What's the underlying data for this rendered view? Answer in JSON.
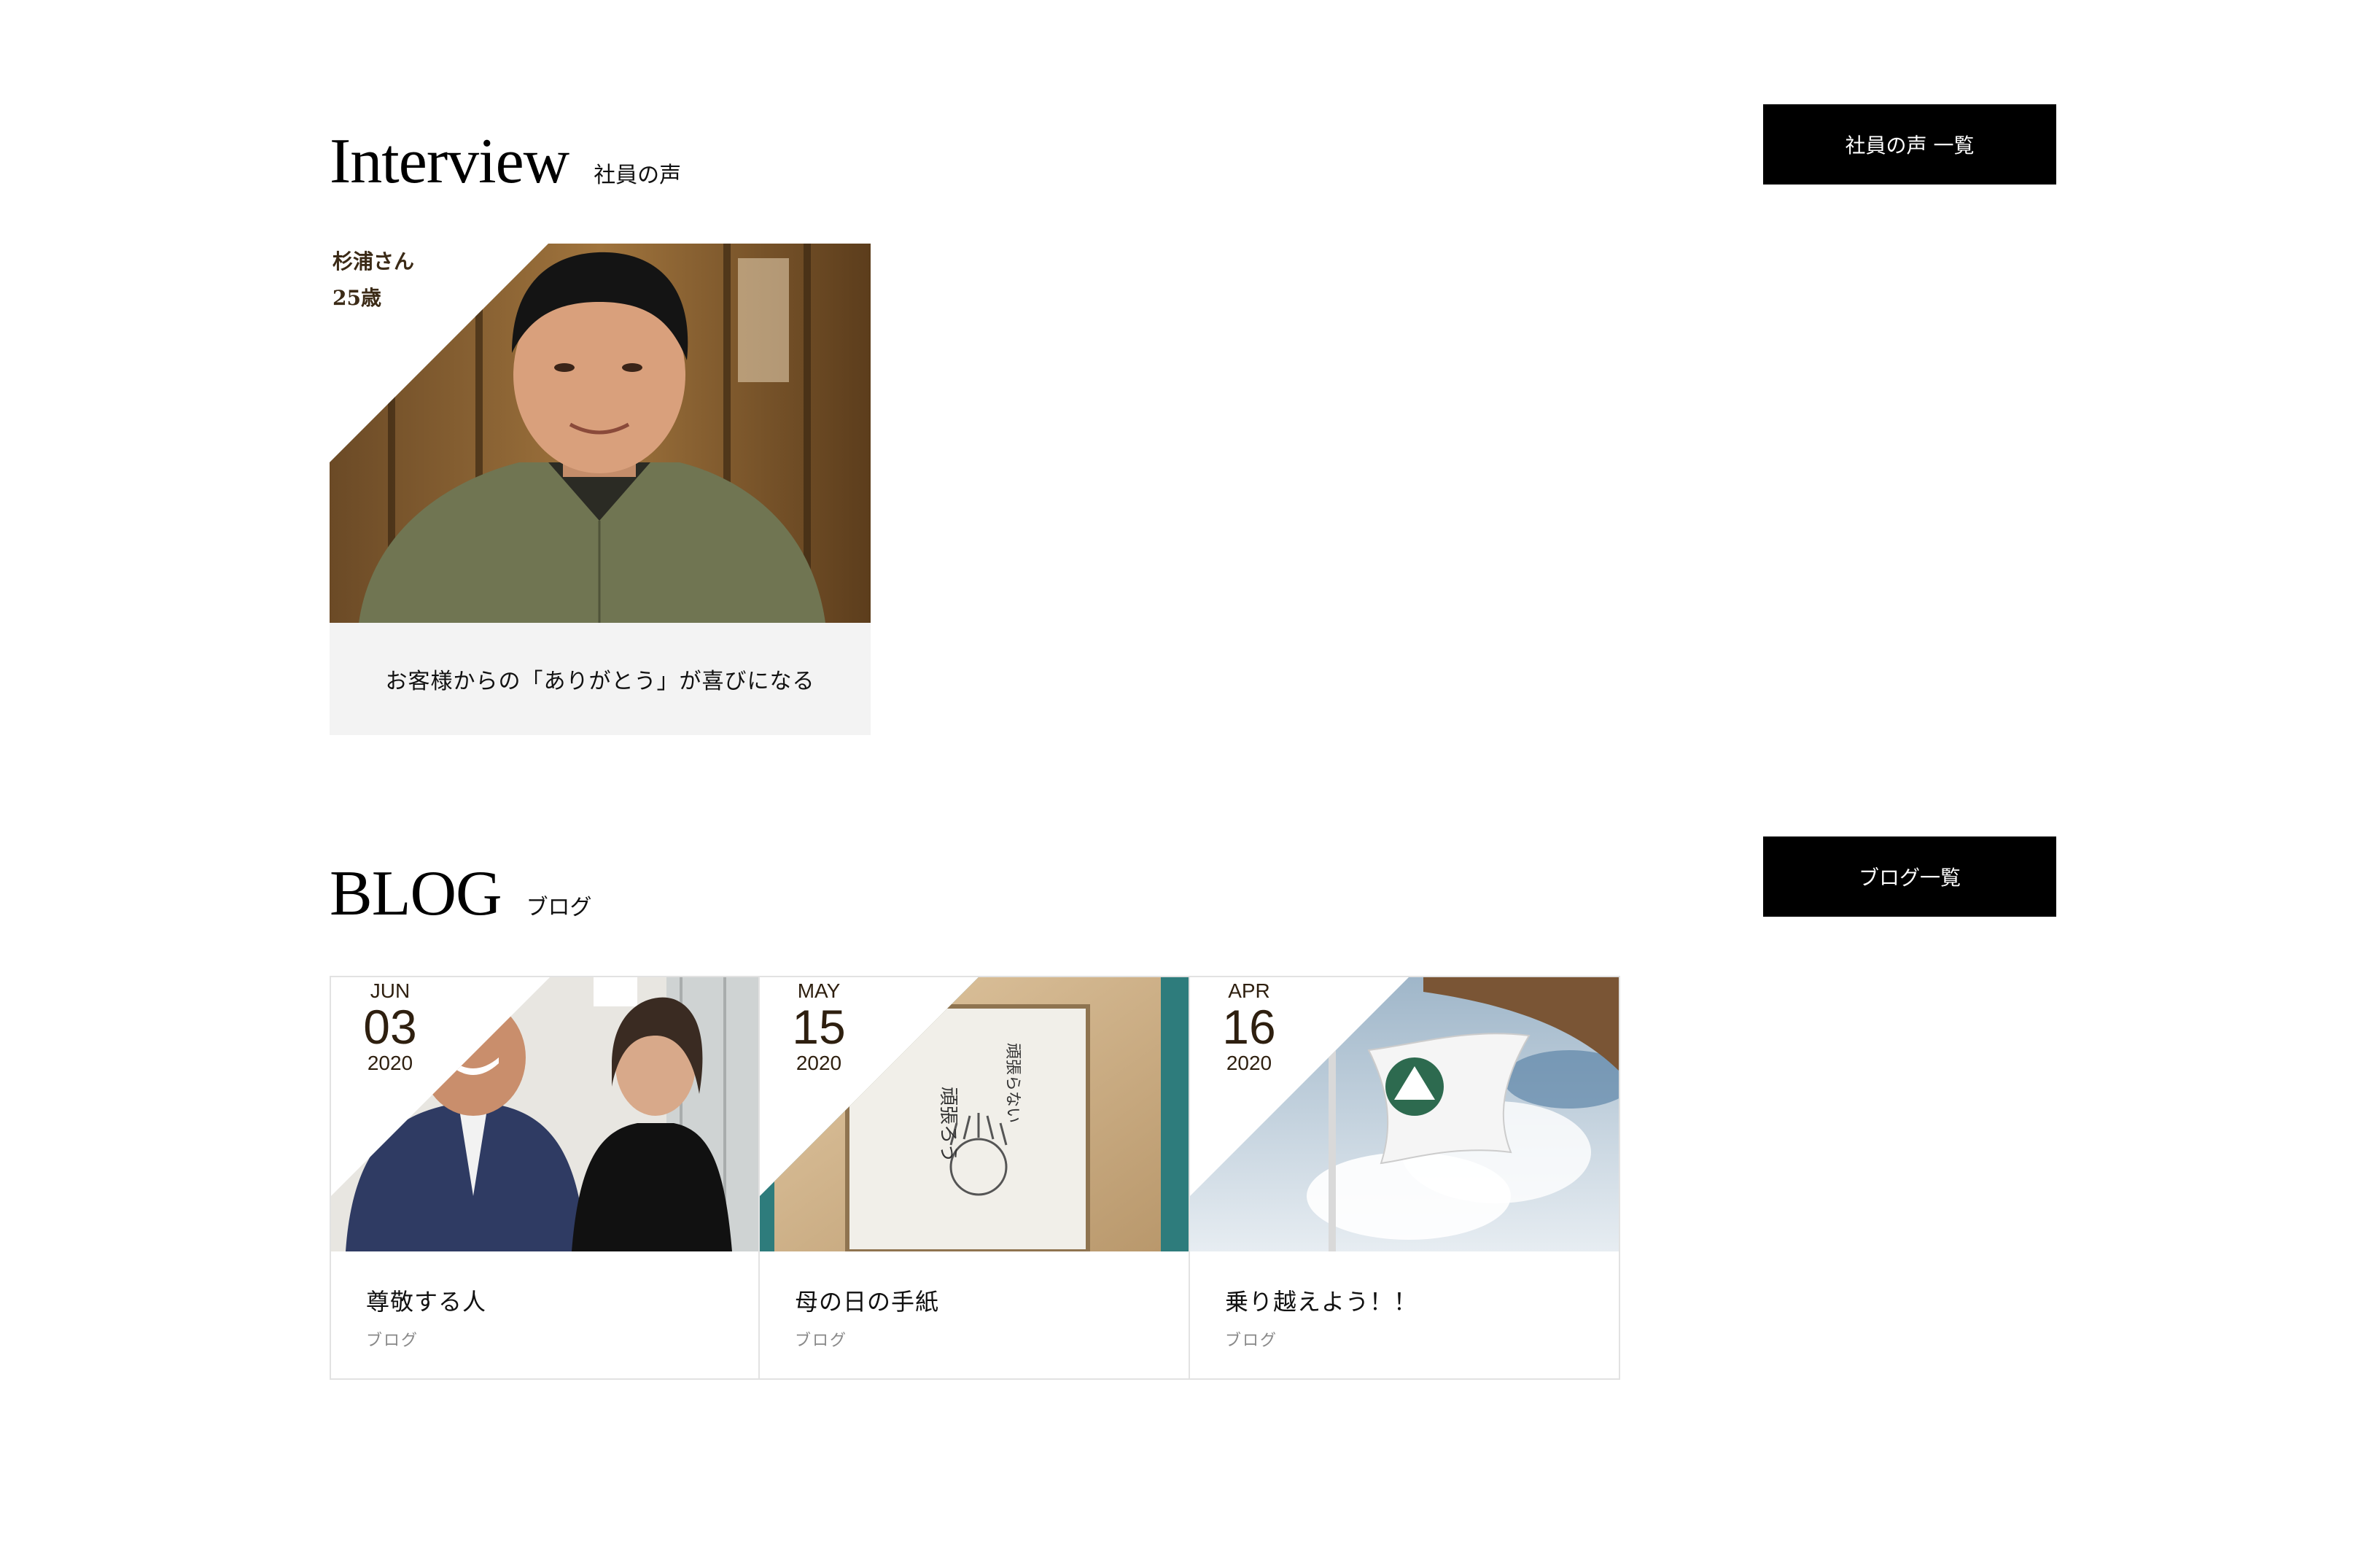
{
  "interview": {
    "title": "Interview",
    "subtitle": "社員の声",
    "list_button": "社員の声 一覧",
    "card": {
      "name": "杉浦さん",
      "age": "25歳",
      "caption": "お客様からの「ありがとう」が喜びになる"
    }
  },
  "blog": {
    "title": "BLOG",
    "subtitle": "ブログ",
    "list_button": "ブログ一覧",
    "posts": [
      {
        "month": "JUN",
        "day": "03",
        "year": "2020",
        "title": "尊敬する人",
        "category": "ブログ"
      },
      {
        "month": "MAY",
        "day": "15",
        "year": "2020",
        "title": "母の日の手紙",
        "category": "ブログ"
      },
      {
        "month": "APR",
        "day": "16",
        "year": "2020",
        "title": "乗り越えよう！！",
        "category": "ブログ"
      }
    ]
  },
  "images": {
    "interview_photo": "portrait-photo",
    "blog_photo_1": "two-people-photo",
    "blog_photo_2": "framed-letter-photo",
    "blog_photo_3": "company-flag-photo"
  },
  "colors": {
    "button_bg": "#000000",
    "button_text": "#ffffff",
    "caption_bg": "#f3f3f3",
    "date_text": "#2e1f0f"
  }
}
